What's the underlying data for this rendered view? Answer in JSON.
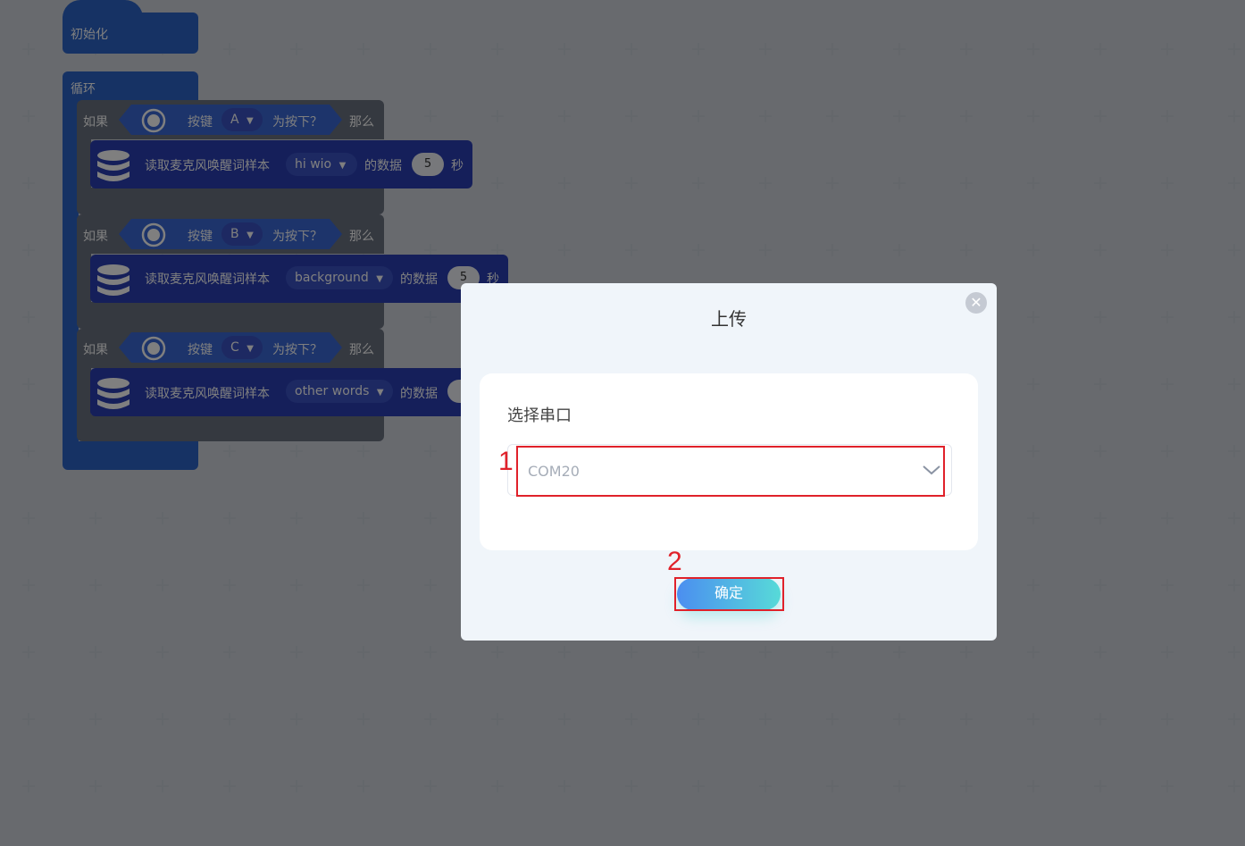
{
  "workspace": {
    "init_label": "初始化",
    "loop_label": "循环",
    "if_blocks": [
      {
        "if_label": "如果",
        "key_label": "按键",
        "key_value": "A",
        "pressed_label": "为按下？",
        "then_label": "那么",
        "read_label": "读取麦克风唤醒词样本",
        "sample_value": "hi wio",
        "data_label": "的数据",
        "seconds_value": "5",
        "sec_unit": "秒"
      },
      {
        "if_label": "如果",
        "key_label": "按键",
        "key_value": "B",
        "pressed_label": "为按下？",
        "then_label": "那么",
        "read_label": "读取麦克风唤醒词样本",
        "sample_value": "background",
        "data_label": "的数据",
        "seconds_value": "5",
        "sec_unit": "秒"
      },
      {
        "if_label": "如果",
        "key_label": "按键",
        "key_value": "C",
        "pressed_label": "为按下？",
        "then_label": "那么",
        "read_label": "读取麦克风唤醒词样本",
        "sample_value": "other words",
        "data_label": "的数据"
      }
    ]
  },
  "modal": {
    "title": "上传",
    "close_icon": "close-icon",
    "port_label": "选择串口",
    "port_value": "COM20",
    "confirm_label": "确定"
  },
  "annotations": {
    "step1": "1",
    "step2": "2",
    "color": "#e0212a"
  },
  "colors": {
    "block_blue": "#2d64c9",
    "mic_block": "#2a3fb5",
    "control_gray": "#6b7280",
    "button_gradient_start": "#4b8ef0",
    "button_gradient_end": "#57dad8"
  }
}
